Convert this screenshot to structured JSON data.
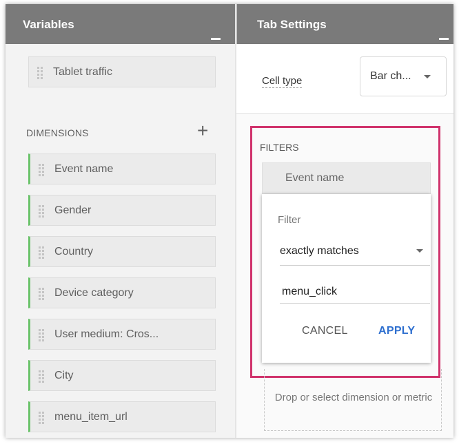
{
  "variables_panel": {
    "title": "Variables",
    "segment_chip": {
      "label": "Tablet traffic"
    },
    "dimensions_label": "DIMENSIONS",
    "add_icon": "plus-icon",
    "dimensions": [
      {
        "label": "Event name"
      },
      {
        "label": "Gender"
      },
      {
        "label": "Country"
      },
      {
        "label": "Device category"
      },
      {
        "label": "User medium: Cros..."
      },
      {
        "label": "City"
      },
      {
        "label": "menu_item_url"
      }
    ],
    "accent_color": "#6bc36b"
  },
  "tab_settings": {
    "title": "Tab Settings",
    "cell_type_label": "Cell type",
    "cell_type_value": "Bar ch...",
    "filters_label": "FILTERS",
    "filter_chip": {
      "label": "Event name"
    },
    "filter_popup": {
      "title": "Filter",
      "match_type": "exactly matches",
      "value": "menu_click",
      "cancel_label": "CANCEL",
      "apply_label": "APPLY"
    },
    "drop_zone_text": "Drop or select dimension or metric",
    "highlight_color": "#d0336c"
  }
}
